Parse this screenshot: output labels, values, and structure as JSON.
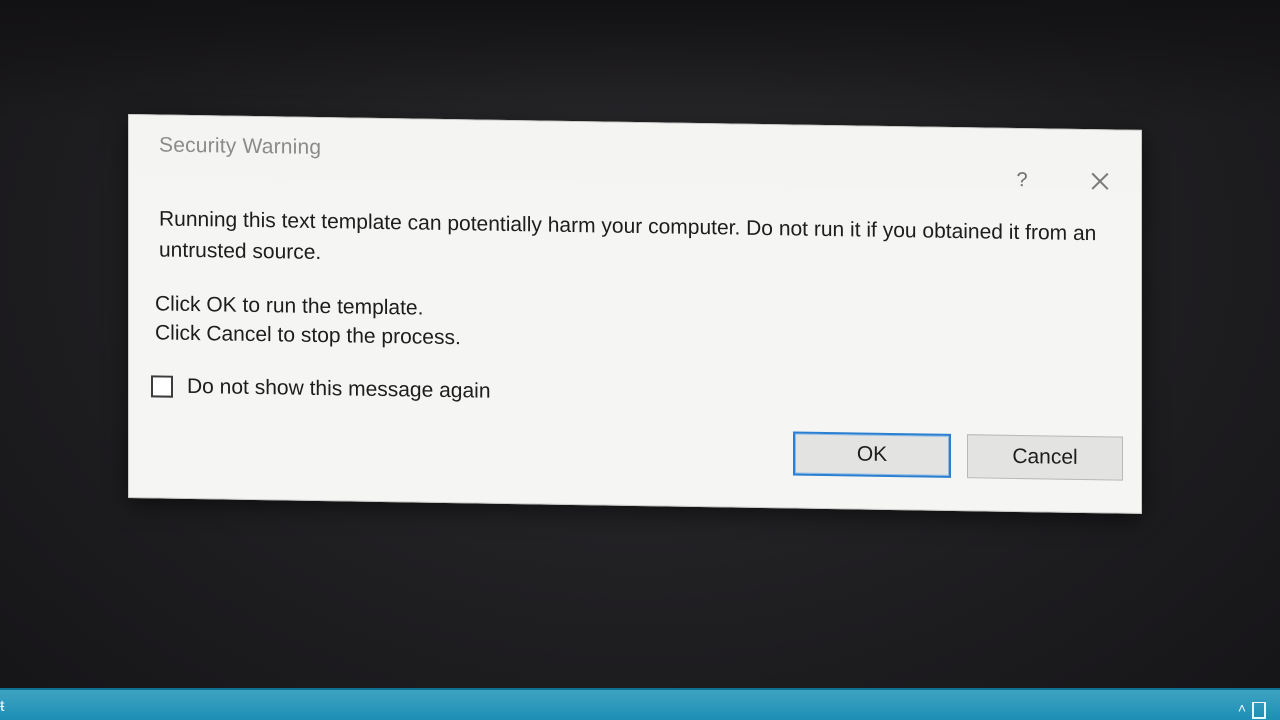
{
  "dialog": {
    "title": "Security Warning",
    "help_symbol": "?",
    "message": "Running this text template can potentially harm your computer. Do not run it if you obtained it from an untrusted source.",
    "instructions": [
      "Click OK to run the template.",
      "Click Cancel to stop the process."
    ],
    "checkbox": {
      "label": "Do not show this message again",
      "checked": false
    },
    "buttons": {
      "ok": "OK",
      "cancel": "Cancel"
    },
    "accent_color": "#2a7fd0",
    "icons": {
      "help": "help-icon",
      "close": "close-icon"
    }
  },
  "taskbar": {
    "color": "#1b8db4"
  }
}
